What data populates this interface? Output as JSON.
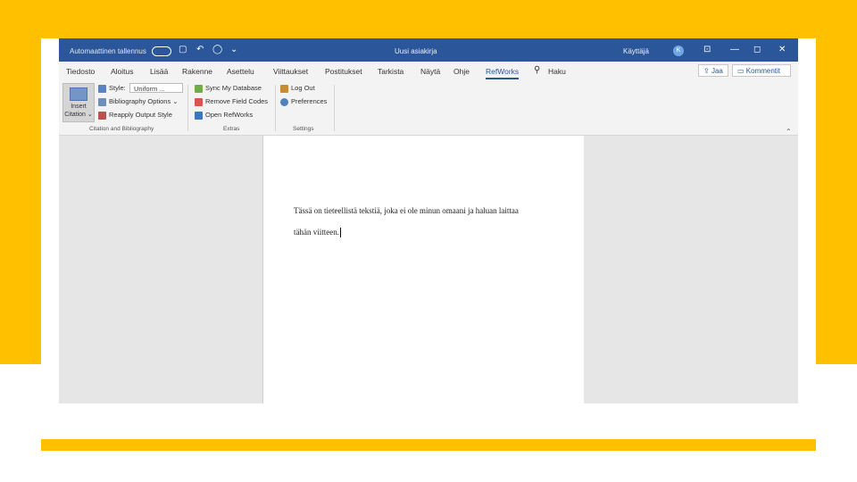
{
  "titlebar": {
    "autosave": "Automaattinen tallennus",
    "document_title": "Uusi asiakirja",
    "user_name": "Käyttäjä",
    "avatar_initial": "K"
  },
  "tabs": [
    {
      "label": "Tiedosto"
    },
    {
      "label": "Aloitus"
    },
    {
      "label": "Lisää"
    },
    {
      "label": "Rakenne"
    },
    {
      "label": "Asettelu"
    },
    {
      "label": "Viittaukset"
    },
    {
      "label": "Postitukset"
    },
    {
      "label": "Tarkista"
    },
    {
      "label": "Näytä"
    },
    {
      "label": "Ohje"
    },
    {
      "label": "RefWorks",
      "active": true
    }
  ],
  "search": {
    "label": "Haku"
  },
  "share": {
    "label": "Jaa"
  },
  "comments": {
    "label": "Kommentit"
  },
  "ribbon": {
    "insert_citation": {
      "line1": "Insert",
      "line2": "Citation"
    },
    "style_label": "Style:",
    "style_value": "Uniform ...",
    "bibliography_options": "Bibliography Options",
    "reapply_output_style": "Reapply Output Style",
    "group1_label": "Citation and Bibliography",
    "sync_database": "Sync My Database",
    "remove_field_codes": "Remove Field Codes",
    "open_refworks": "Open RefWorks",
    "group2_label": "Extras",
    "log_out": "Log Out",
    "preferences": "Preferences",
    "group3_label": "Settings"
  },
  "document": {
    "line1": "Tässä on tieteellistä tekstiä, joka ei ole minun omaani ja haluan laittaa",
    "line2": "tähän viitteen."
  },
  "colors": {
    "accent_yellow": "#FFC000",
    "word_blue": "#2b579a"
  }
}
